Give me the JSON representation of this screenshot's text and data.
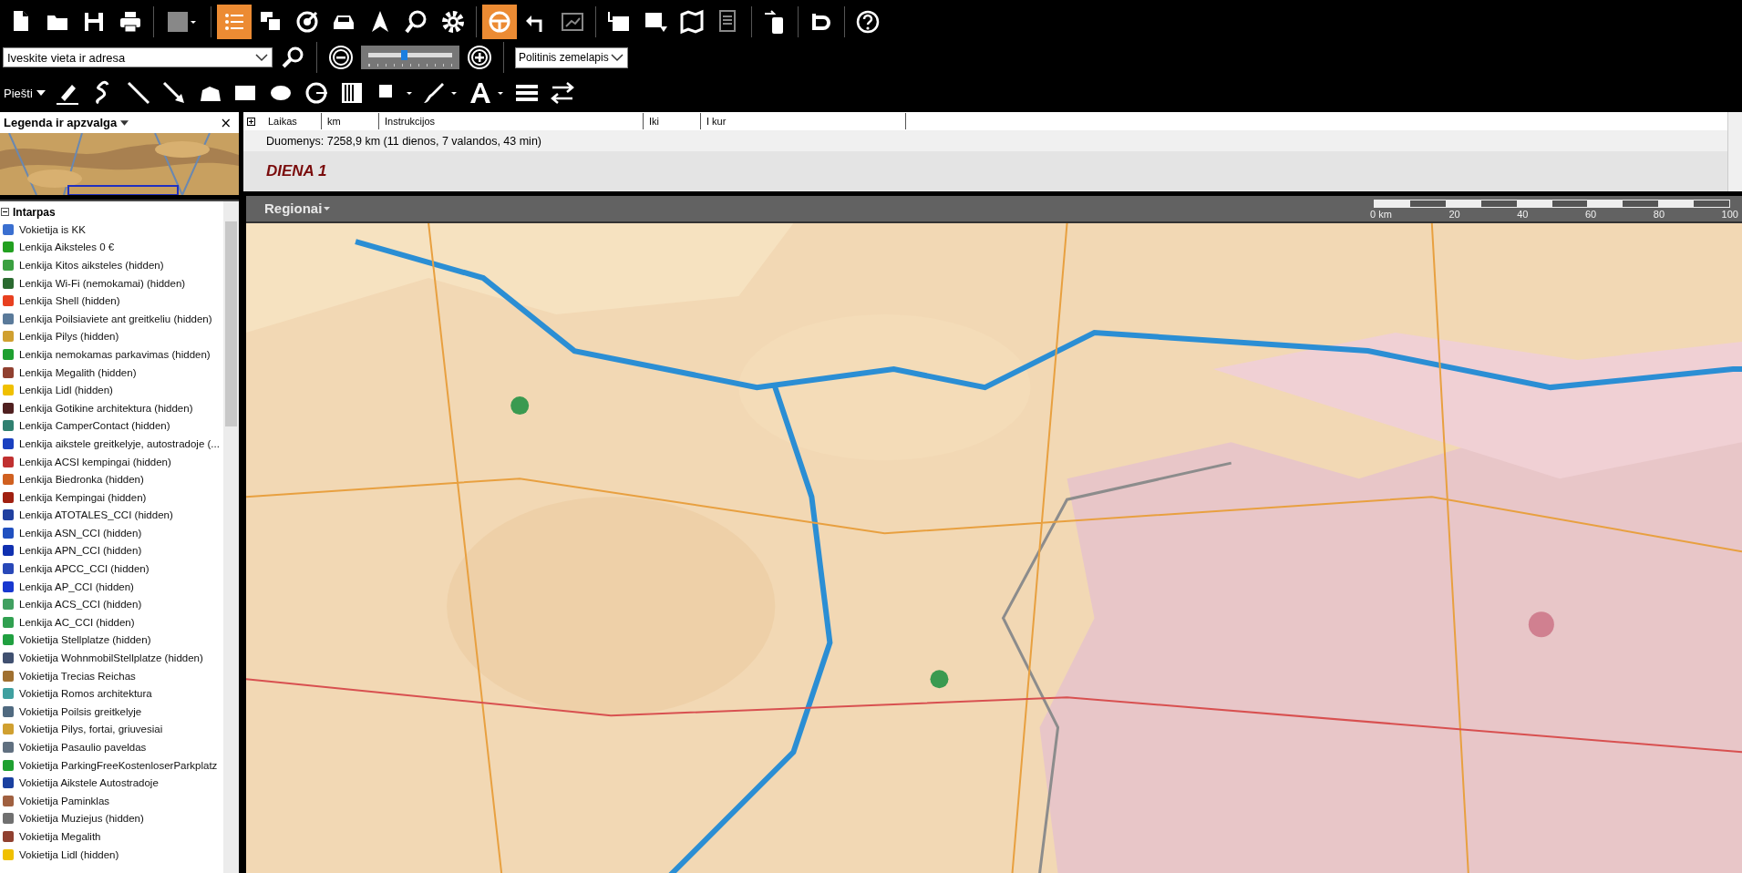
{
  "toolbar": {
    "buttons": [
      {
        "on": false
      },
      {
        "on": false
      },
      {
        "on": false
      },
      {
        "on": false
      },
      {
        "on": false
      },
      {
        "on": true
      },
      {
        "on": false
      },
      {
        "on": false
      },
      {
        "on": false
      },
      {
        "on": false
      },
      {
        "on": false
      },
      {
        "on": false
      },
      {
        "on": true
      },
      {
        "on": false
      },
      {
        "on": false
      },
      {
        "on": false
      },
      {
        "on": false
      },
      {
        "on": false
      },
      {
        "on": false
      },
      {
        "on": false
      },
      {
        "on": false
      },
      {
        "on": false
      }
    ]
  },
  "search": {
    "value": "Iveskite vieta ir adresa"
  },
  "zoom": {
    "level": 0.42
  },
  "map_type": {
    "value": "Politinis zemelapis"
  },
  "draw_menu": {
    "label": "Piešti"
  },
  "sidebar": {
    "title": "Legenda ir apzvalga",
    "close": "×",
    "group": {
      "label": "Intarpas",
      "expanded": true,
      "items": [
        {
          "label": "Vokietija is KK",
          "color": "#3a6fd0"
        },
        {
          "label": "Lenkija Aiksteles 0 €",
          "color": "#22a020"
        },
        {
          "label": "Lenkija Kitos aiksteles (hidden)",
          "color": "#3aa040"
        },
        {
          "label": "Lenkija Wi-Fi (nemokamai) (hidden)",
          "color": "#2a6a30"
        },
        {
          "label": "Lenkija Shell (hidden)",
          "color": "#e84020"
        },
        {
          "label": "Lenkija Poilsiaviete ant greitkeliu (hidden)",
          "color": "#5a7a9a"
        },
        {
          "label": "Lenkija Pilys (hidden)",
          "color": "#d0a030"
        },
        {
          "label": "Lenkija nemokamas parkavimas (hidden)",
          "color": "#1ea030"
        },
        {
          "label": "Lenkija Megalith (hidden)",
          "color": "#904030"
        },
        {
          "label": "Lenkija Lidl (hidden)",
          "color": "#f0c000"
        },
        {
          "label": "Lenkija Gotikine architektura (hidden)",
          "color": "#502020"
        },
        {
          "label": "Lenkija CamperContact (hidden)",
          "color": "#308070"
        },
        {
          "label": "Lenkija aikstele greitkelyje, autostradoje (...",
          "color": "#1a40c0"
        },
        {
          "label": "Lenkija ACSI kempingai (hidden)",
          "color": "#c03030"
        },
        {
          "label": "Lenkija Biedronka (hidden)",
          "color": "#d06020"
        },
        {
          "label": "Lenkija Kempingai (hidden)",
          "color": "#a02010"
        },
        {
          "label": "Lenkija ATOTALES_CCI (hidden)",
          "color": "#2040a0"
        },
        {
          "label": "Lenkija ASN_CCI (hidden)",
          "color": "#2050c0"
        },
        {
          "label": "Lenkija APN_CCI (hidden)",
          "color": "#1030b0"
        },
        {
          "label": "Lenkija APCC_CCI (hidden)",
          "color": "#2848b8"
        },
        {
          "label": "Lenkija AP_CCI (hidden)",
          "color": "#1838d0"
        },
        {
          "label": "Lenkija ACS_CCI (hidden)",
          "color": "#40a060"
        },
        {
          "label": "Lenkija AC_CCI (hidden)",
          "color": "#30a050"
        },
        {
          "label": "Vokietija Stellplatze (hidden)",
          "color": "#20a040"
        },
        {
          "label": "Vokietija WohnmobilStellplatze (hidden)",
          "color": "#405070"
        },
        {
          "label": "Vokietija Trecias Reichas",
          "color": "#a07030"
        },
        {
          "label": "Vokietija Romos architektura",
          "color": "#40a0a0"
        },
        {
          "label": "Vokietija Poilsis greitkelyje",
          "color": "#506a80"
        },
        {
          "label": "Vokietija Pilys, fortai, griuvesiai",
          "color": "#d0a030"
        },
        {
          "label": "Vokietija Pasaulio paveldas",
          "color": "#607080"
        },
        {
          "label": "Vokietija ParkingFreeKostenloserParkplatz",
          "color": "#1ea030"
        },
        {
          "label": "Vokietija Aikstele Autostradoje",
          "color": "#1a40a0"
        },
        {
          "label": "Vokietija Paminklas",
          "color": "#a06040"
        },
        {
          "label": "Vokietija Muziejus (hidden)",
          "color": "#707070"
        },
        {
          "label": "Vokietija Megalith",
          "color": "#904030"
        },
        {
          "label": "Vokietija Lidl (hidden)",
          "color": "#f0c000"
        }
      ]
    }
  },
  "route": {
    "columns": [
      "Laikas",
      "km",
      "Instrukcijos",
      "Iki",
      "I kur"
    ],
    "summary": "Duomenys:  7258,9 km (11 dienos, 7 valandos, 43 min)",
    "day": "DIENA 1"
  },
  "map": {
    "layer": "Regionai",
    "scale": [
      "0 km",
      "20",
      "40",
      "60",
      "80",
      "100"
    ]
  }
}
